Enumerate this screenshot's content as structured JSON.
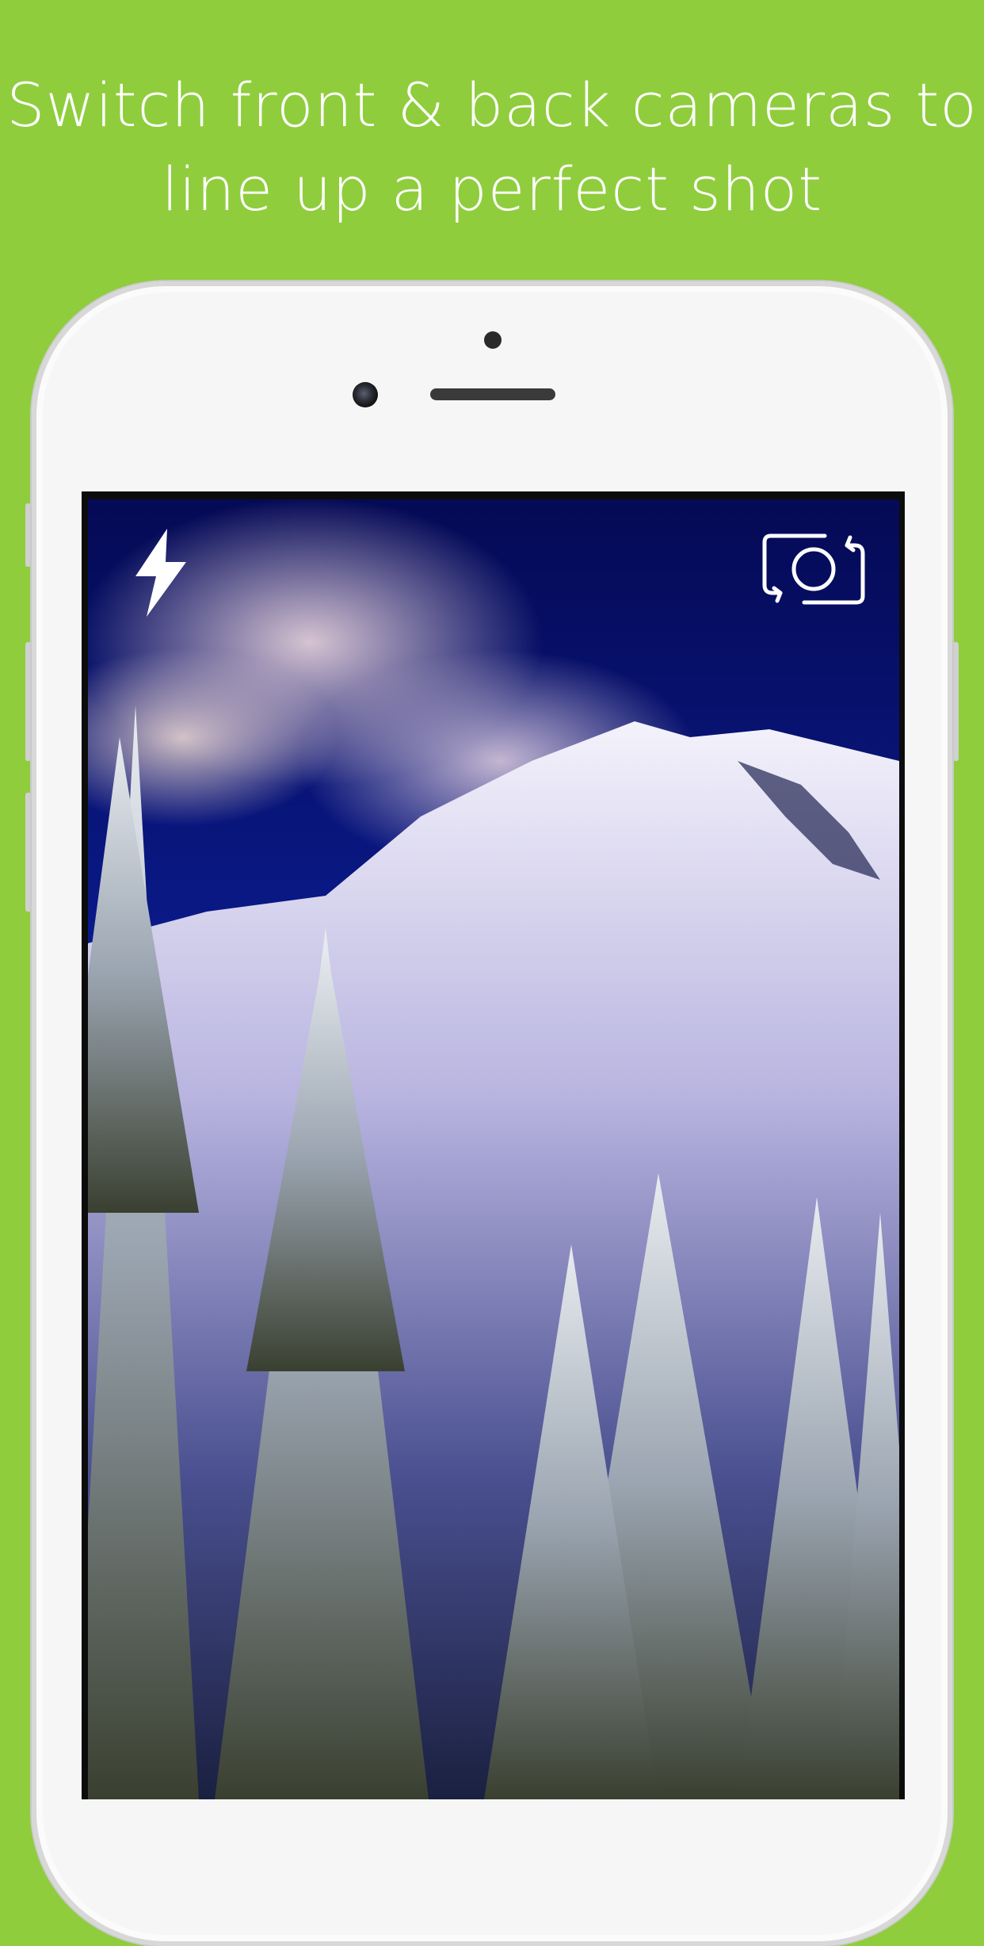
{
  "headline": {
    "line1": "Switch front & back cameras to",
    "line2": "line up a perfect shot"
  },
  "colors": {
    "background": "#8fcd3d",
    "phone_body": "#f6f6f6"
  },
  "camera": {
    "flash_icon": "lightning-bolt-icon",
    "switch_icon": "camera-switch-icon"
  }
}
